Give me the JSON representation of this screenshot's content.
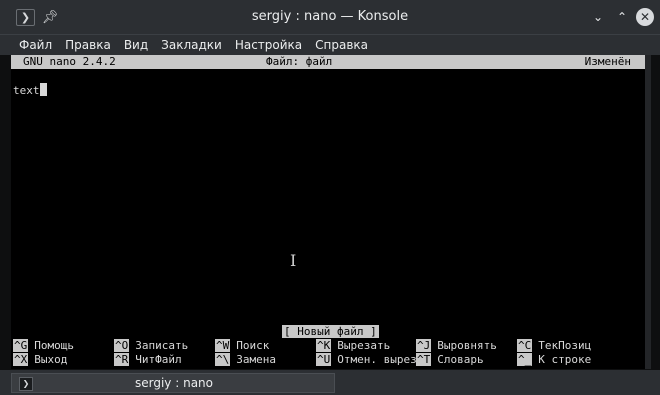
{
  "window": {
    "title": "sergiy : nano — Konsole",
    "menu_icon": "terminal-menu-icon",
    "pin_icon": "pin-icon",
    "buttons": [
      "minimize-icon",
      "maximize-icon",
      "close-icon"
    ]
  },
  "menubar": {
    "items": [
      "Файл",
      "Правка",
      "Вид",
      "Закладки",
      "Настройка",
      "Справка"
    ]
  },
  "nano": {
    "version": "GNU nano 2.4.2",
    "file": "Файл: файл",
    "modified": "Изменён",
    "content": "text",
    "status": "[ Новый файл ]",
    "shortcuts_row1": [
      {
        "key": "^G",
        "label": "Помощь"
      },
      {
        "key": "^O",
        "label": "Записать"
      },
      {
        "key": "^W",
        "label": "Поиск"
      },
      {
        "key": "^K",
        "label": "Вырезать"
      },
      {
        "key": "^J",
        "label": "Выровнять"
      },
      {
        "key": "^C",
        "label": "ТекПозиц"
      }
    ],
    "shortcuts_row2": [
      {
        "key": "^X",
        "label": "Выход"
      },
      {
        "key": "^R",
        "label": "ЧитФайл"
      },
      {
        "key": "^\\",
        "label": "Замена"
      },
      {
        "key": "^U",
        "label": "Отмен. вырез"
      },
      {
        "key": "^T",
        "label": "Словарь"
      },
      {
        "key": "^_",
        "label": "К строке"
      }
    ]
  },
  "tabs": [
    {
      "label": "sergiy : nano",
      "icon": "terminal-tab-icon"
    }
  ],
  "colors": {
    "chrome": "#2c2f33",
    "terminal_bg": "#000000",
    "terminal_fg": "#d9d9d9",
    "inverse_bg": "#c8c8c8"
  }
}
